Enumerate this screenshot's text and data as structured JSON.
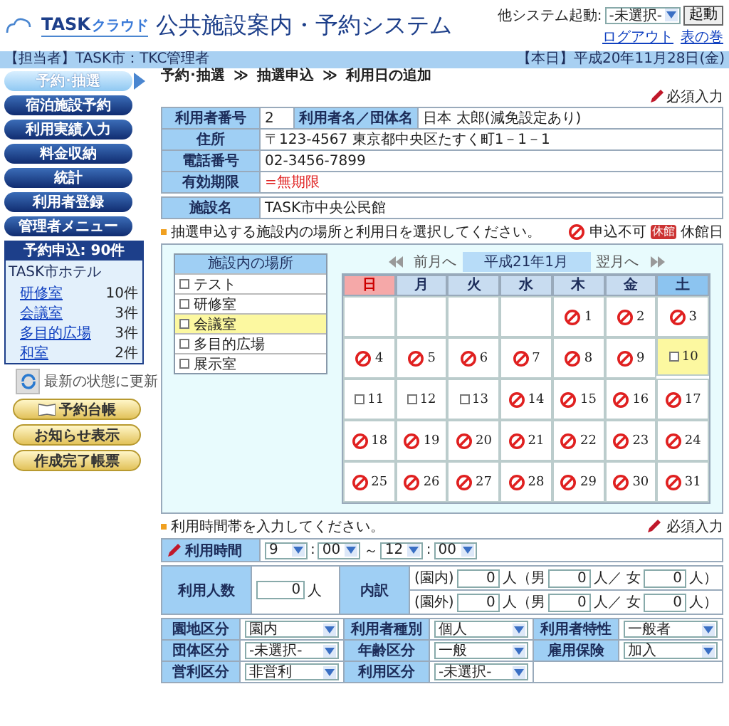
{
  "header": {
    "brand": "TASK",
    "brand_sub": "クラウド",
    "title": "公共施設案内・予約システム",
    "launcher_label": "他システム起動:",
    "launcher_value": "-未選択-",
    "launch_button": "起動",
    "links": [
      "ログアウト",
      "表の巻"
    ]
  },
  "user_bar": {
    "user": "【担当者】TASK市：TKC管理者",
    "date": "【本日】平成20年11月28日(金)"
  },
  "sidebar": {
    "menu": [
      {
        "label": "予約･抽選",
        "selected": true
      },
      {
        "label": "宿泊施設予約",
        "selected": false
      },
      {
        "label": "利用実績入力",
        "selected": false
      },
      {
        "label": "料金収納",
        "selected": false
      },
      {
        "label": "統計",
        "selected": false
      },
      {
        "label": "利用者登録",
        "selected": false
      },
      {
        "label": "管理者メニュー",
        "selected": false
      }
    ],
    "reservations": {
      "title": "予約申込: 90件",
      "facility": "TASK市ホテル",
      "rooms": [
        {
          "name": "研修室",
          "count": "10件"
        },
        {
          "name": "会議室",
          "count": "3件"
        },
        {
          "name": "多目的広場",
          "count": "3件"
        },
        {
          "name": "和室",
          "count": "2件"
        }
      ]
    },
    "refresh": "最新の状態に更新",
    "actions": [
      "予約台帳",
      "お知らせ表示",
      "作成完了帳票"
    ]
  },
  "breadcrumb": {
    "items": [
      "予約･抽選",
      "抽選申込",
      "利用日の追加"
    ],
    "separator": "≫"
  },
  "required_note": "必須入力",
  "user_info": [
    {
      "label": "利用者番号",
      "value": "2",
      "label2": "利用者名／団体名",
      "value2": "日本 太郎(減免設定あり)"
    },
    {
      "label": "住所",
      "value": "〒123-4567 東京都中央区たすく町1－1－1"
    },
    {
      "label": "電話番号",
      "value": "02-3456-7899"
    },
    {
      "label": "有効期限",
      "value": "=無期限",
      "kind": "warning"
    }
  ],
  "facility": {
    "label": "施設名",
    "value": "TASK市中央公民館"
  },
  "lottery": {
    "instruction": "抽選申込する施設内の場所と利用日を選択してください。",
    "legend": [
      {
        "kind": "unavailable",
        "label": "申込不可"
      },
      {
        "kind": "closed",
        "icon_text": "休館",
        "label": "休館日"
      }
    ],
    "places": {
      "title": "施設内の場所",
      "items": [
        {
          "label": "テスト",
          "checked": false,
          "selected": false
        },
        {
          "label": "研修室",
          "checked": false,
          "selected": false
        },
        {
          "label": "会議室",
          "checked": false,
          "selected": true
        },
        {
          "label": "多目的広場",
          "checked": false,
          "selected": false
        },
        {
          "label": "展示室",
          "checked": false,
          "selected": false
        }
      ]
    },
    "calendar": {
      "prev": "前月へ",
      "next": "翌月へ",
      "month": "平成21年1月",
      "weekdays": [
        {
          "label": "日",
          "kind": "sun"
        },
        {
          "label": "月",
          "kind": "weekday"
        },
        {
          "label": "火",
          "kind": "weekday"
        },
        {
          "label": "水",
          "kind": "weekday"
        },
        {
          "label": "木",
          "kind": "weekday"
        },
        {
          "label": "金",
          "kind": "weekday"
        },
        {
          "label": "土",
          "kind": "sat"
        }
      ],
      "days": [
        {
          "kind": "blank"
        },
        {
          "kind": "blank"
        },
        {
          "kind": "blank"
        },
        {
          "kind": "blank"
        },
        {
          "day": "1",
          "kind": "unavailable",
          "selected": false
        },
        {
          "day": "2",
          "kind": "unavailable",
          "selected": false
        },
        {
          "day": "3",
          "kind": "unavailable",
          "selected": false
        },
        {
          "day": "4",
          "kind": "unavailable",
          "selected": false
        },
        {
          "day": "5",
          "kind": "unavailable",
          "selected": false
        },
        {
          "day": "6",
          "kind": "unavailable",
          "selected": false
        },
        {
          "day": "7",
          "kind": "unavailable",
          "selected": false
        },
        {
          "day": "8",
          "kind": "unavailable",
          "selected": false
        },
        {
          "day": "9",
          "kind": "unavailable",
          "selected": false
        },
        {
          "day": "10",
          "kind": "available",
          "checked": false,
          "selected": true
        },
        {
          "day": "11",
          "kind": "available",
          "checked": false,
          "selected": false
        },
        {
          "day": "12",
          "kind": "available",
          "checked": false,
          "selected": false
        },
        {
          "day": "13",
          "kind": "available",
          "checked": false,
          "selected": false
        },
        {
          "day": "14",
          "kind": "unavailable",
          "selected": false
        },
        {
          "day": "15",
          "kind": "unavailable",
          "selected": false
        },
        {
          "day": "16",
          "kind": "unavailable",
          "selected": false
        },
        {
          "day": "17",
          "kind": "unavailable",
          "selected": false
        },
        {
          "day": "18",
          "kind": "unavailable",
          "selected": false
        },
        {
          "day": "19",
          "kind": "unavailable",
          "selected": false
        },
        {
          "day": "20",
          "kind": "unavailable",
          "selected": false
        },
        {
          "day": "21",
          "kind": "unavailable",
          "selected": false
        },
        {
          "day": "22",
          "kind": "unavailable",
          "selected": false
        },
        {
          "day": "23",
          "kind": "unavailable",
          "selected": false
        },
        {
          "day": "24",
          "kind": "unavailable",
          "selected": false
        },
        {
          "day": "25",
          "kind": "unavailable",
          "selected": false
        },
        {
          "day": "26",
          "kind": "unavailable",
          "selected": false
        },
        {
          "day": "27",
          "kind": "unavailable",
          "selected": false
        },
        {
          "day": "28",
          "kind": "unavailable",
          "selected": false
        },
        {
          "day": "29",
          "kind": "unavailable",
          "selected": false
        },
        {
          "day": "30",
          "kind": "unavailable",
          "selected": false
        },
        {
          "day": "31",
          "kind": "unavailable",
          "selected": false
        }
      ]
    }
  },
  "usage": {
    "instruction": "利用時間帯を入力してください。",
    "required_note": "必須入力",
    "time": {
      "label": "利用時間",
      "start_hour": "9",
      "colon": ":",
      "start_min": "00",
      "separator": "～",
      "end_hour": "12",
      "end_min": "00"
    },
    "people": {
      "label": "利用人数",
      "value": "0",
      "unit": "人",
      "breakdown_label": "内訳",
      "lines": [
        [
          {
            "kind": "text",
            "text": "(園内)"
          },
          {
            "kind": "input",
            "value": "0"
          },
          {
            "kind": "text",
            "text": "人（男"
          },
          {
            "kind": "input",
            "value": "0"
          },
          {
            "kind": "text",
            "text": "人／ 女"
          },
          {
            "kind": "input",
            "value": "0"
          },
          {
            "kind": "text",
            "text": "人）"
          }
        ],
        [
          {
            "kind": "text",
            "text": "(園外)"
          },
          {
            "kind": "input",
            "value": "0"
          },
          {
            "kind": "text",
            "text": "人（男"
          },
          {
            "kind": "input",
            "value": "0"
          },
          {
            "kind": "text",
            "text": "人／ 女"
          },
          {
            "kind": "input",
            "value": "0"
          },
          {
            "kind": "text",
            "text": "人）"
          }
        ]
      ]
    },
    "selects": [
      [
        {
          "label": "園地区分",
          "value": "園内"
        },
        {
          "label": "利用者種別",
          "value": "個人"
        },
        {
          "label": "利用者特性",
          "value": "一般者"
        }
      ],
      [
        {
          "label": "団体区分",
          "value": "-未選択-"
        },
        {
          "label": "年齢区分",
          "value": "一般"
        },
        {
          "label": "雇用保険",
          "value": "加入"
        }
      ],
      [
        {
          "label": "営利区分",
          "value": "非営利"
        },
        {
          "label": "利用区分",
          "value": "-未選択-"
        }
      ]
    ]
  }
}
